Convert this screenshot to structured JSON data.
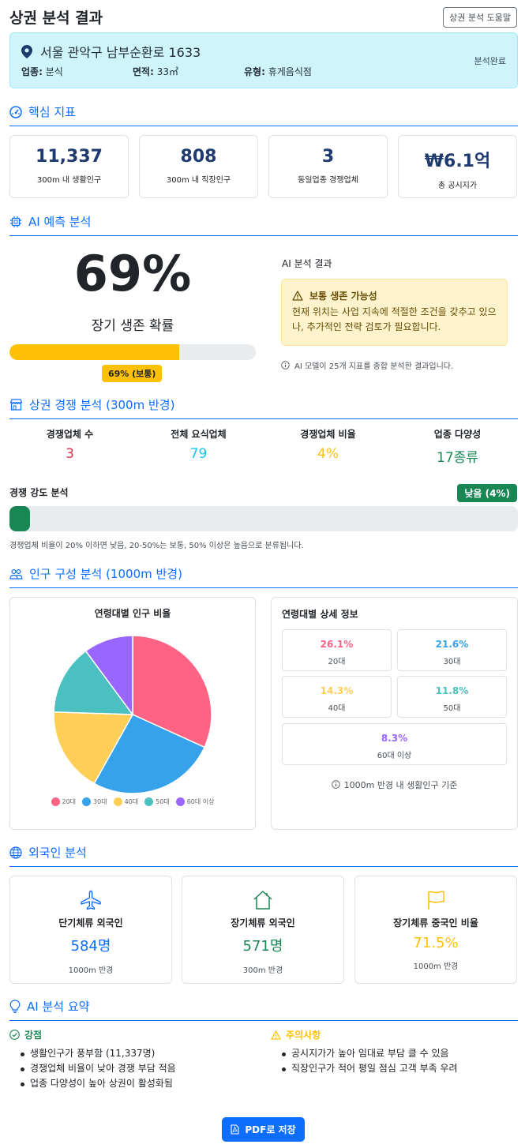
{
  "header": {
    "title": "상권 분석 결과",
    "help_label": "상권 분석 도움말"
  },
  "address": {
    "text": "서울 관악구 남부순환로 1633",
    "industry_label": "업종:",
    "industry_value": "분식",
    "area_label": "면적:",
    "area_value": "33㎡",
    "type_label": "유형:",
    "type_value": "휴게음식점",
    "status": "분석완료"
  },
  "kpi": {
    "title": "핵심 지표",
    "items": [
      {
        "value": "11,337",
        "label": "300m 내 생활인구"
      },
      {
        "value": "808",
        "label": "300m 내 직장인구"
      },
      {
        "value": "3",
        "label": "동일업종 경쟁업체"
      },
      {
        "value": "₩6.1억",
        "label": "총 공시지가"
      }
    ]
  },
  "ai": {
    "title": "AI 예측 분석",
    "percent_text": "69%",
    "survival_label": "장기 생존 확률",
    "survival_fraction": 0.69,
    "badge": "69% (보통)",
    "result_title": "AI 분석 결과",
    "warning_title": "보통 생존 가능성",
    "warning_text": "현재 위치는 사업 지속에 적절한 조건을 갖추고 있으나, 추가적인 전략 검토가 필요합니다.",
    "note": "AI 모델이 25개 지표를 종합 분석한 결과입니다.",
    "colors": {
      "bar": "#ffc107"
    }
  },
  "competition": {
    "title": "상권 경쟁 분석 (300m 반경)",
    "stats": [
      {
        "label": "경쟁업체 수",
        "value": "3",
        "color": "#dc3545"
      },
      {
        "label": "전체 요식업체",
        "value": "79",
        "color": "#0dcaf0"
      },
      {
        "label": "경쟁업체 비율",
        "value": "4%",
        "color": "#ffc107"
      },
      {
        "label": "업종 다양성",
        "value": "17종류",
        "color": "#198754"
      }
    ],
    "intensity_label": "경쟁 강도 분석",
    "intensity_badge": "낮음 (4%)",
    "intensity_fraction": 0.04,
    "intensity_note": "경쟁업체 비율이 20% 이하면 낮음, 20-50%는 보통, 50% 이상은 높음으로 분류됩니다."
  },
  "population": {
    "title": "인구 구성 분석 (1000m 반경)",
    "chart_title": "연령대별 인구 비율",
    "detail_title": "연령대별 상세 정보",
    "groups": [
      {
        "pct": "26.1%",
        "age": "20대",
        "color": "#ff6384"
      },
      {
        "pct": "21.6%",
        "age": "30대",
        "color": "#36a2eb"
      },
      {
        "pct": "14.3%",
        "age": "40대",
        "color": "#ffce56"
      },
      {
        "pct": "11.8%",
        "age": "50대",
        "color": "#4bc0c0"
      },
      {
        "pct": "8.3%",
        "age": "60대 이상",
        "color": "#9966ff"
      }
    ],
    "note": "1000m 반경 내 생활인구 기준"
  },
  "chart_data": {
    "type": "pie",
    "title": "연령대별 인구 비율",
    "categories": [
      "20대",
      "30대",
      "40대",
      "50대",
      "60대 이상"
    ],
    "values": [
      26.1,
      21.6,
      14.3,
      11.8,
      8.3
    ],
    "colors": [
      "#ff6384",
      "#36a2eb",
      "#ffce56",
      "#4bc0c0",
      "#9966ff"
    ],
    "legend": "bottom"
  },
  "foreigners": {
    "title": "외국인 분석",
    "items": [
      {
        "icon": "airplane-icon",
        "label": "단기체류 외국인",
        "value": "584명",
        "sub": "1000m 반경",
        "color": "#0d6efd"
      },
      {
        "icon": "house-icon",
        "label": "장기체류 외국인",
        "value": "571명",
        "sub": "300m 반경",
        "color": "#198754"
      },
      {
        "icon": "flag-icon",
        "label": "장기체류 중국인 비율",
        "value": "71.5%",
        "sub": "1000m 반경",
        "color": "#ffc107"
      }
    ]
  },
  "summary": {
    "title": "AI 분석 요약",
    "strengths_title": "강점",
    "strengths": [
      "생활인구가 풍부함 (11,337명)",
      "경쟁업체 비율이 낮아 경쟁 부담 적음",
      "업종 다양성이 높아 상권이 활성화됨"
    ],
    "cautions_title": "주의사항",
    "cautions": [
      "공시지가가 높아 임대료 부담 클 수 있음",
      "직장인구가 적어 평일 점심 고객 부족 우려"
    ]
  },
  "actions": {
    "pdf_label": "PDF로 저장"
  }
}
